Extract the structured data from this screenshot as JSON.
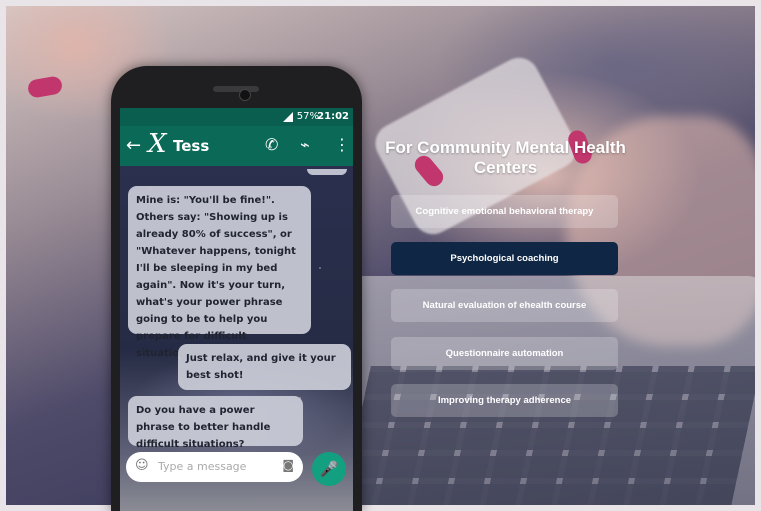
{
  "phone": {
    "status": {
      "battery": "57%",
      "time": "21:02"
    },
    "header": {
      "back_icon": "←",
      "logo": "X",
      "contact_name": "Tess",
      "call_icon": "✆",
      "attach_icon": "⌁",
      "menu_icon": "⋮"
    },
    "messages": [
      {
        "from": "bot",
        "text": "Mine is: \"You'll be fine!\". Others say: \"Showing up is already 80% of success\", or \"Whatever happens, tonight I'll be sleeping in my bed again\". Now it's your turn, what's your power phrase going to be to help you prepare for difficult situations?"
      },
      {
        "from": "user",
        "text": "Just relax, and give it your best shot!"
      },
      {
        "from": "bot",
        "text": "Do you have a power phrase to better handle difficult situations?"
      }
    ],
    "composer": {
      "placeholder": "Type a message",
      "emoji_icon": "☺",
      "camera_icon": "◙",
      "mic_icon": "🎤"
    }
  },
  "panel": {
    "title": "For Community Mental Health Centers",
    "options": [
      {
        "label": "Cognitive emotional behavioral therapy",
        "active": false
      },
      {
        "label": "Psychological coaching",
        "active": true
      },
      {
        "label": "Natural evaluation of ehealth course",
        "active": false
      },
      {
        "label": "Questionnaire automation",
        "active": false
      },
      {
        "label": "Improving therapy adherence",
        "active": false
      }
    ]
  },
  "colors": {
    "header_green": "#0b6957",
    "active_option": "#0f2744",
    "mic_green": "#13a081"
  }
}
